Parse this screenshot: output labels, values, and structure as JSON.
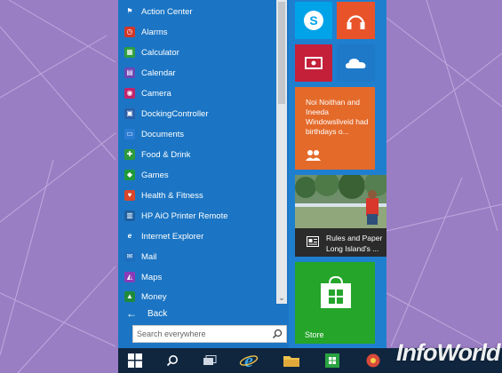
{
  "colors": {
    "desktop": "#9a7ec4",
    "apps_panel": "#1b75c4",
    "skype": "#00a2e8",
    "music": "#e8532a",
    "video": "#c4203a",
    "onedrive": "#1e79c8",
    "people": "#e46a2a",
    "news": "#2b2b2b",
    "store": "#25a52a",
    "taskbar": "#10263f"
  },
  "apps": [
    {
      "label": "Action Center",
      "icon": "flag-icon",
      "color": "#1b75c4"
    },
    {
      "label": "Alarms",
      "icon": "alarm-clock-icon",
      "color": "#d1362a"
    },
    {
      "label": "Calculator",
      "icon": "calculator-icon",
      "color": "#2e9e3e"
    },
    {
      "label": "Calendar",
      "icon": "calendar-icon",
      "color": "#6c46b5"
    },
    {
      "label": "Camera",
      "icon": "camera-icon",
      "color": "#c0246b"
    },
    {
      "label": "DockingController",
      "icon": "generic-app-icon",
      "color": "#2a5fa8"
    },
    {
      "label": "Documents",
      "icon": "documents-icon",
      "color": "#2a7cd3"
    },
    {
      "label": "Food & Drink",
      "icon": "food-drink-icon",
      "color": "#2c9a3d"
    },
    {
      "label": "Games",
      "icon": "games-icon",
      "color": "#1f9a3a"
    },
    {
      "label": "Health & Fitness",
      "icon": "health-heart-icon",
      "color": "#d8462b"
    },
    {
      "label": "HP AiO Printer Remote",
      "icon": "printer-icon",
      "color": "#1d5fa0"
    },
    {
      "label": "Internet Explorer",
      "icon": "internet-explorer-icon",
      "color": "#1b75c4"
    },
    {
      "label": "Mail",
      "icon": "mail-icon",
      "color": "#1f6fc0"
    },
    {
      "label": "Maps",
      "icon": "maps-icon",
      "color": "#8b3ab7"
    },
    {
      "label": "Money",
      "icon": "money-icon",
      "color": "#1e8a3c"
    }
  ],
  "back": {
    "label": "Back"
  },
  "search": {
    "placeholder": "Search everywhere"
  },
  "tiles": {
    "skype": {
      "icon": "skype-icon"
    },
    "music": {
      "icon": "headphones-icon"
    },
    "video": {
      "icon": "video-icon"
    },
    "onedrive": {
      "icon": "cloud-icon"
    },
    "people": {
      "text": "Noi Noithan and Ineeda Windowsliveid had birthdays o...",
      "icon": "people-icon"
    },
    "news": {
      "headline": "Rules and Paper Long Island's ...",
      "icon": "news-icon"
    },
    "store": {
      "label": "Store",
      "icon": "store-bag-icon"
    }
  },
  "taskbar": {
    "items": [
      {
        "name": "start",
        "icon": "windows-logo-icon"
      },
      {
        "name": "search",
        "icon": "search-icon"
      },
      {
        "name": "task-view",
        "icon": "task-view-icon"
      },
      {
        "name": "internet-explorer",
        "icon": "internet-explorer-icon"
      },
      {
        "name": "file-explorer",
        "icon": "folder-icon"
      },
      {
        "name": "store",
        "icon": "store-icon"
      },
      {
        "name": "other",
        "icon": "app-icon"
      }
    ]
  },
  "watermark": {
    "text": "InfoWorld"
  }
}
